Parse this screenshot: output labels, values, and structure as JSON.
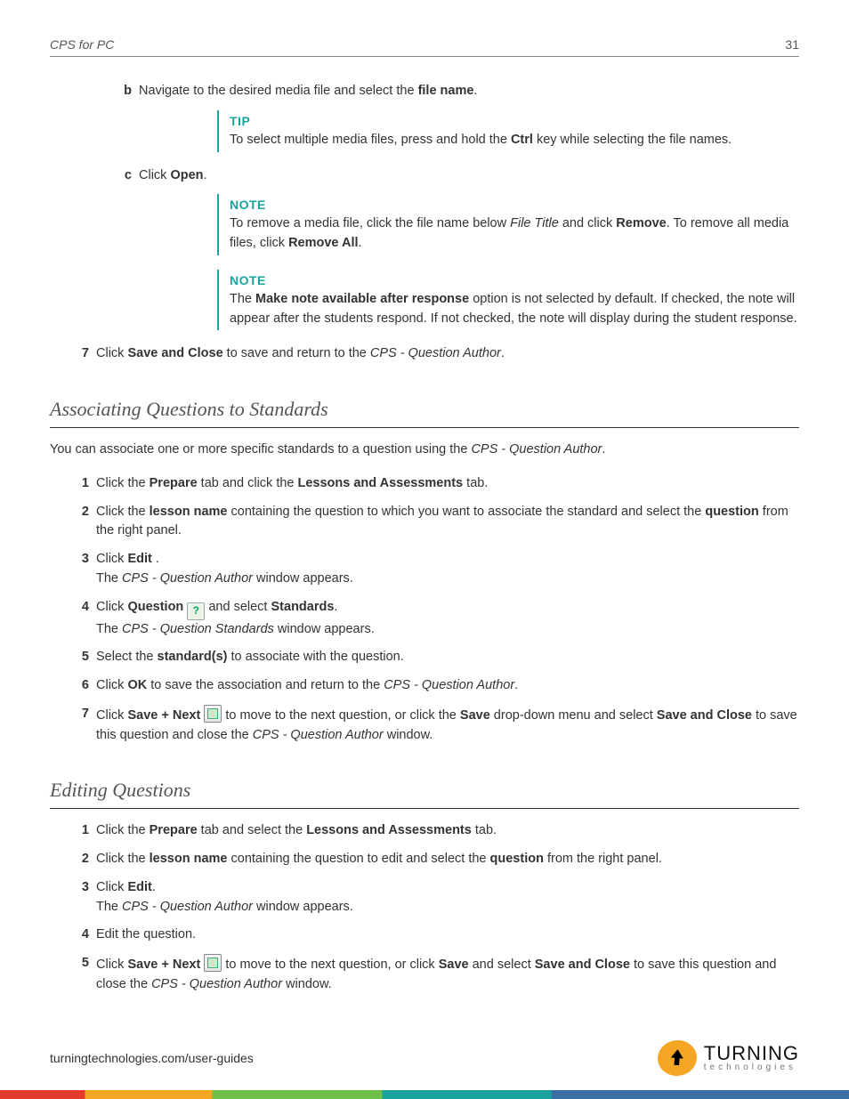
{
  "header": {
    "title": "CPS for PC",
    "page_number": "31"
  },
  "section_b": {
    "marker": "b",
    "text_parts": [
      "Navigate to the desired media file and select the ",
      "file name",
      "."
    ]
  },
  "tip": {
    "label": "TIP",
    "text_parts": [
      "To select multiple media files, press and hold the ",
      "Ctrl",
      " key while selecting the file names."
    ]
  },
  "section_c": {
    "marker": "c",
    "text_parts": [
      "Click ",
      "Open",
      "."
    ]
  },
  "note1": {
    "label": "NOTE",
    "text_parts": [
      "To remove a media file, click the file name below ",
      "File Title",
      " and click ",
      "Remove",
      ". To remove all media files, click ",
      "Remove All",
      "."
    ]
  },
  "note2": {
    "label": "NOTE",
    "text_parts": [
      "The ",
      "Make note available after response",
      " option is not selected by default. If checked, the note will appear after the students respond. If not checked, the note will display during the student response."
    ]
  },
  "step7_top": {
    "marker": "7",
    "text_parts": [
      "Click ",
      "Save and Close",
      " to save and return to the ",
      "CPS - Question Author",
      "."
    ]
  },
  "heading_assoc": "Associating Questions to Standards",
  "assoc_intro_parts": [
    "You can associate one or more specific standards to a question using the ",
    "CPS - Question Author",
    "."
  ],
  "assoc_steps": {
    "s1": {
      "marker": "1",
      "parts": [
        "Click the ",
        "Prepare",
        " tab and click the ",
        "Lessons and Assessments",
        " tab."
      ]
    },
    "s2": {
      "marker": "2",
      "parts": [
        "Click the ",
        "lesson name",
        " containing the question to which you want to associate the standard and select the ",
        "question",
        " from the right panel."
      ]
    },
    "s3": {
      "marker": "3",
      "line1_parts": [
        "Click ",
        "Edit",
        " ."
      ],
      "line2_parts": [
        "The ",
        "CPS - Question Author",
        " window appears."
      ]
    },
    "s4": {
      "marker": "4",
      "line1_parts_a": [
        "Click ",
        "Question",
        " "
      ],
      "line1_parts_b": [
        " and select ",
        "Standards",
        "."
      ],
      "line2_parts": [
        "The ",
        "CPS - Question Standards",
        " window appears."
      ]
    },
    "s5": {
      "marker": "5",
      "parts": [
        "Select the ",
        "standard(s)",
        " to associate with the question."
      ]
    },
    "s6": {
      "marker": "6",
      "parts": [
        "Click ",
        "OK",
        " to save the association and return to the ",
        "CPS - Question Author",
        "."
      ]
    },
    "s7": {
      "marker": "7",
      "parts_a": [
        "Click ",
        "Save + Next",
        " "
      ],
      "parts_b": [
        " to move to the next question, or click the ",
        "Save",
        " drop-down menu  and select ",
        "Save and Close",
        " to save this question and close the ",
        "CPS - Question Author",
        " window."
      ]
    }
  },
  "heading_edit": "Editing Questions",
  "edit_steps": {
    "s1": {
      "marker": "1",
      "parts": [
        "Click the ",
        "Prepare",
        " tab and select the ",
        "Lessons and Assessments",
        " tab."
      ]
    },
    "s2": {
      "marker": "2",
      "parts": [
        "Click the ",
        "lesson name",
        " containing the question to edit and select the ",
        "question",
        " from the right panel."
      ]
    },
    "s3": {
      "marker": "3",
      "line1_parts": [
        "Click ",
        "Edit",
        "."
      ],
      "line2_parts": [
        "The ",
        "CPS - Question Author",
        " window appears."
      ]
    },
    "s4": {
      "marker": "4",
      "parts": [
        "Edit the question."
      ]
    },
    "s5": {
      "marker": "5",
      "parts_a": [
        "Click ",
        "Save + Next",
        " "
      ],
      "parts_b": [
        " to move to the next question, or click ",
        "Save",
        " and select ",
        "Save and Close",
        " to save this question and close the ",
        "CPS - Question Author",
        " window."
      ]
    }
  },
  "footer": {
    "url": "turningtechnologies.com/user-guides",
    "logo_big": "TURNING",
    "logo_small": "technologies"
  }
}
